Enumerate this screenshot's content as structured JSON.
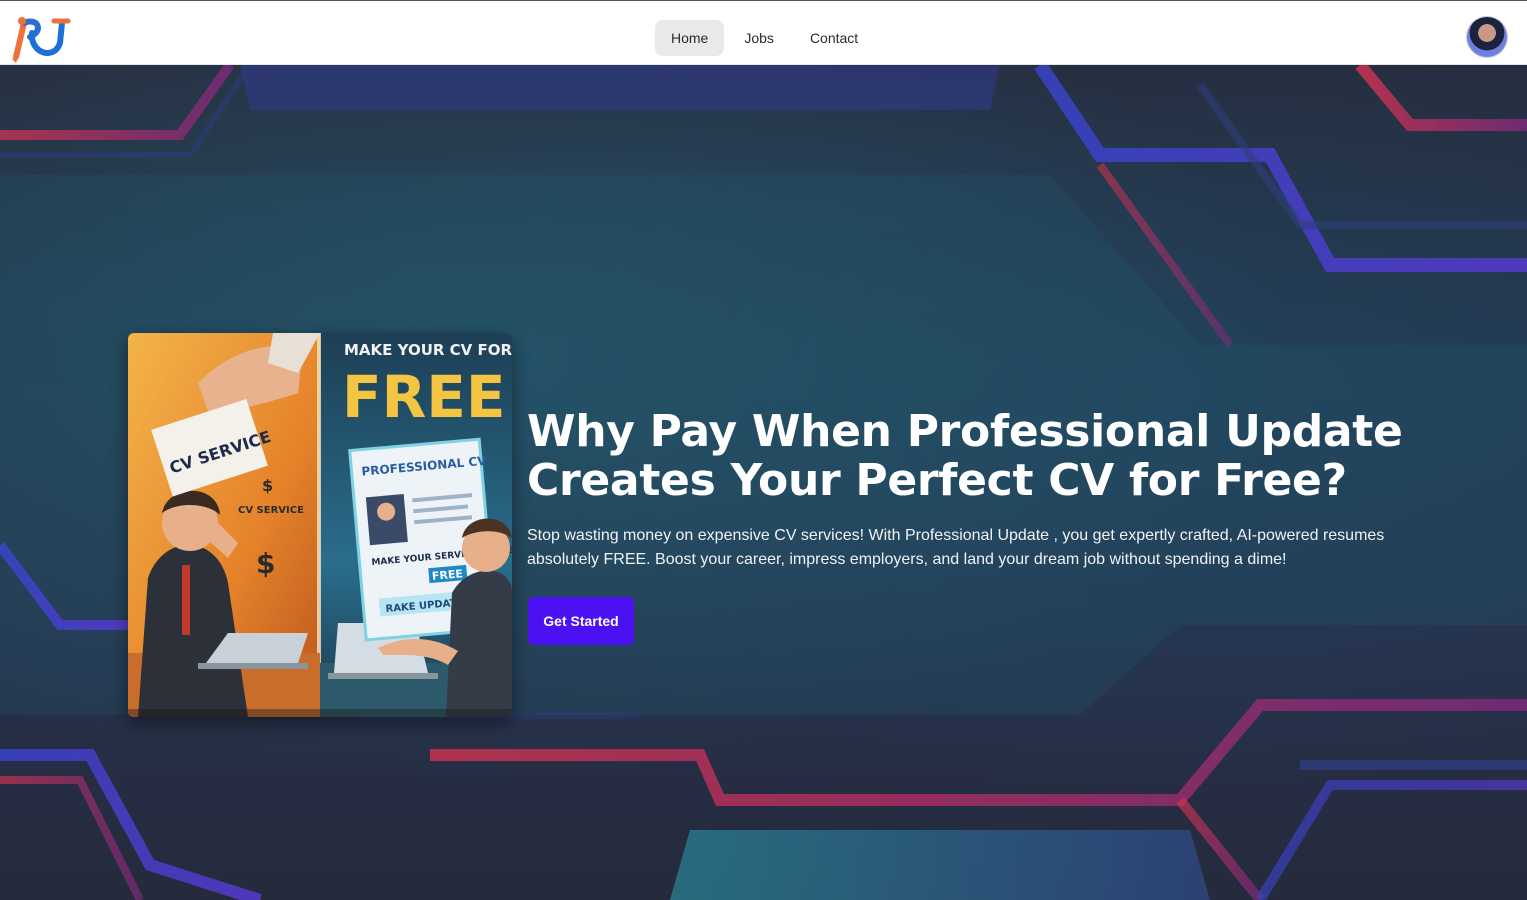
{
  "nav": {
    "items": [
      {
        "label": "Home",
        "active": true
      },
      {
        "label": "Jobs",
        "active": false
      },
      {
        "label": "Contact",
        "active": false
      }
    ]
  },
  "hero": {
    "headline": "Why Pay When Professional Update Creates Your Perfect CV for Free?",
    "subtext": "Stop wasting money on expensive CV services! With Professional Update , you get expertly crafted, AI-powered resumes absolutely FREE. Boost your career, impress employers, and land your dream job without spending a dime!",
    "cta_label": "Get Started",
    "image": {
      "banner_top": "MAKE YOUR CV FOR",
      "banner_big": "FREE!",
      "cv_service": "CV SERVICE",
      "cv_service_script": "SERVICE",
      "cv_service_small": "CV SERVICE",
      "professional_cv": "PROFESSIONAL CV",
      "make_your": "MAKE YOUR SERVICE PAYMENT",
      "free_tag": "FREE",
      "update_tag": "RAKE UPDATE"
    }
  },
  "colors": {
    "cta": "#4b11f2",
    "hero_bg": "#262a3b",
    "accent_red": "#c8334f",
    "accent_blue": "#3a44d0",
    "accent_teal": "#2a8fa0"
  }
}
